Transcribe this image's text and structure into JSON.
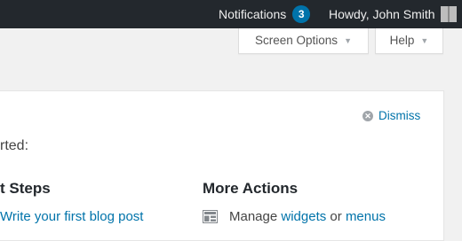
{
  "admin_bar": {
    "notifications_label": "Notifications",
    "notifications_count": "3",
    "howdy": "Howdy, John Smith"
  },
  "screen_tabs": {
    "screen_options_label": "Screen Options",
    "help_label": "Help"
  },
  "welcome_panel": {
    "dismiss_label": "Dismiss",
    "subtitle_visible": "rted:",
    "first_steps_title_visible": "t Steps",
    "more_actions_title": "More Actions",
    "first_link_visible": "Write your first blog post",
    "manage_text": "Manage",
    "widgets_link": "widgets",
    "or_text": "or",
    "menus_link": "menus"
  },
  "colors": {
    "admin_bar_bg": "#23282d",
    "link": "#0073aa",
    "badge": "#0073aa",
    "page_bg": "#f1f1f1"
  },
  "icons": [
    "dismiss-icon",
    "dashboard-widgets-icon",
    "chevron-down-icon"
  ]
}
